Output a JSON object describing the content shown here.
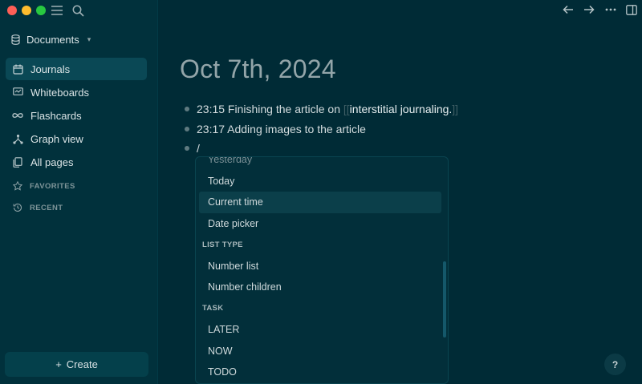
{
  "sidebar": {
    "graph_name": "Documents",
    "nav": [
      {
        "label": "Journals",
        "icon": "calendar-icon",
        "active": true
      },
      {
        "label": "Whiteboards",
        "icon": "whiteboard-icon"
      },
      {
        "label": "Flashcards",
        "icon": "infinity-icon"
      },
      {
        "label": "Graph view",
        "icon": "hierarchy-icon"
      },
      {
        "label": "All pages",
        "icon": "files-icon"
      }
    ],
    "favorites_label": "FAVORITES",
    "recent_label": "RECENT",
    "create_label": "Create",
    "create_prefix": "+"
  },
  "main": {
    "title": "Oct 7th, 2024",
    "blocks": [
      {
        "prefix": "23:15 Finishing the article on ",
        "link_open": "[[",
        "link": "interstitial journaling.",
        "link_close": "]]"
      },
      {
        "text": "23:17 Adding images to the article"
      },
      {
        "text": "/"
      }
    ]
  },
  "popup": {
    "cut_item": "Yesterday",
    "items": [
      {
        "label": "Today"
      },
      {
        "label": "Current time",
        "highlighted": true
      },
      {
        "label": "Date picker"
      }
    ],
    "group_list_type": "LIST TYPE",
    "list_items": [
      {
        "label": "Number list"
      },
      {
        "label": "Number children"
      }
    ],
    "group_task": "TASK",
    "task_items": [
      {
        "label": "LATER"
      },
      {
        "label": "NOW"
      },
      {
        "label": "TODO"
      }
    ]
  },
  "help_label": "?",
  "colors": {
    "background": "#002b36",
    "sidebar": "#01313c",
    "active_nav": "#0a4855",
    "popup_highlight": "#0b3f4a"
  }
}
